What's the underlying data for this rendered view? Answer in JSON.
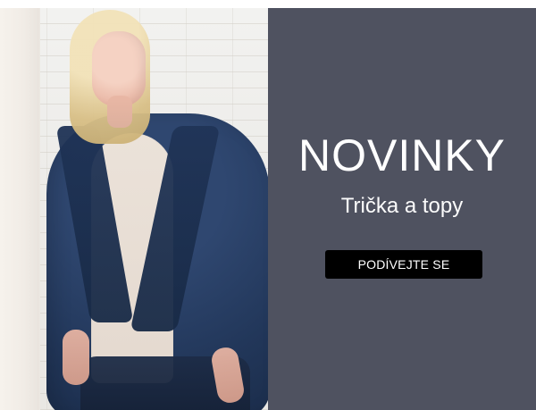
{
  "promo": {
    "headline": "NOVINKY",
    "subhead": "Trička a topy",
    "cta_label": "PODÍVEJTE SE"
  },
  "colors": {
    "panel_bg": "#4f5260",
    "cta_bg": "#000000",
    "text": "#ffffff",
    "jacket": "#22375a"
  }
}
